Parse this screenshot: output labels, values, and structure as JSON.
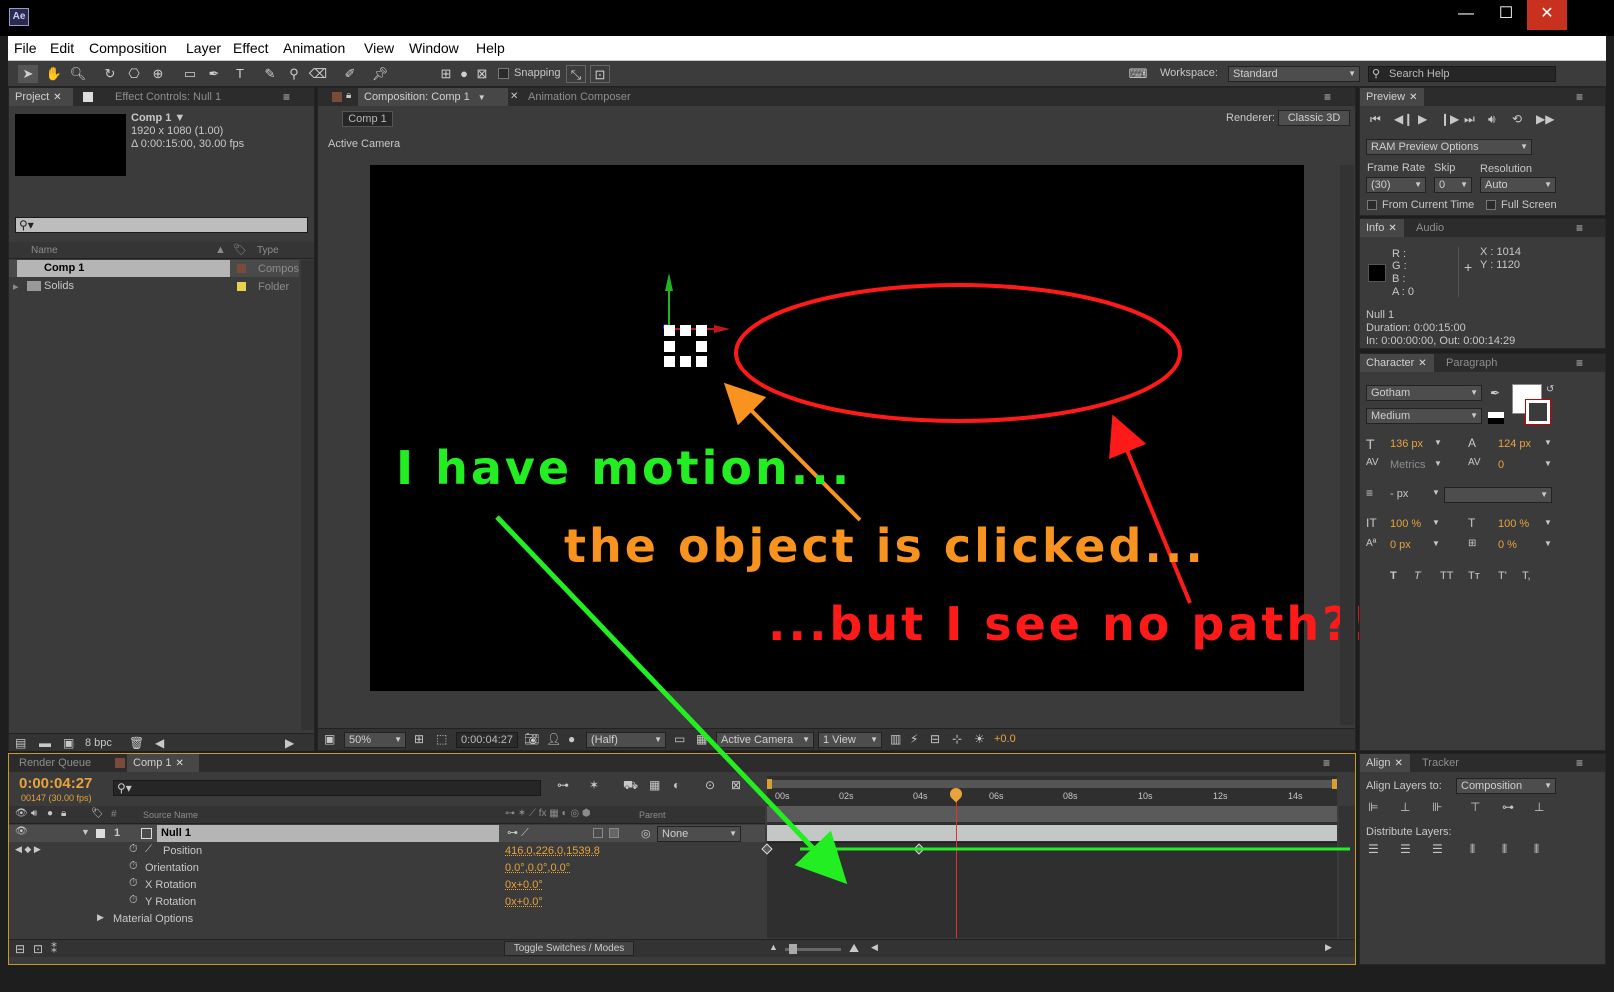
{
  "window": {
    "app_icon": "Ae",
    "min": "—",
    "max": "☐",
    "close": "✕"
  },
  "menu": [
    "File",
    "Edit",
    "Composition",
    "Layer",
    "Effect",
    "Animation",
    "View",
    "Window",
    "Help"
  ],
  "toolbar": {
    "snapping": "Snapping",
    "workspace_label": "Workspace:",
    "workspace_value": "Standard",
    "search_placeholder": "Search Help"
  },
  "project": {
    "tab": "Project",
    "effect_tab": "Effect Controls: Null 1",
    "comp_name": "Comp 1 ▼",
    "comp_size": "1920 x 1080 (1.00)",
    "comp_duration": "Δ 0:00:15:00, 30.00 fps",
    "col_name": "Name",
    "col_type": "Type",
    "items": [
      {
        "name": "Comp 1",
        "type": "Compos"
      },
      {
        "name": "Solids",
        "type": "Folder"
      }
    ],
    "bpc": "8 bpc"
  },
  "composition": {
    "tab": "Composition: Comp 1",
    "tab2": "Animation Composer",
    "crumb": "Comp 1",
    "renderer_label": "Renderer:",
    "renderer_value": "Classic 3D",
    "view_label": "Active Camera",
    "zoom": "50%",
    "timecode": "0:00:04:27",
    "resolution": "(Half)",
    "camera": "Active Camera",
    "views": "1 View",
    "exposure": "+0.0"
  },
  "annotations": {
    "motion": "I have motion...",
    "clicked": "the object is clicked...",
    "nopath": "...but I see no path?!"
  },
  "preview": {
    "tab": "Preview",
    "ram": "RAM Preview Options",
    "frame_rate_label": "Frame Rate",
    "skip_label": "Skip",
    "resolution_label": "Resolution",
    "frame_rate": "(30)",
    "skip": "0",
    "resolution": "Auto",
    "from_current": "From Current Time",
    "full_screen": "Full Screen"
  },
  "info": {
    "tab": "Info",
    "tab2": "Audio",
    "r": "R :",
    "g": "G :",
    "b": "B :",
    "a": "A : 0",
    "x": "X : 1014",
    "y": "Y : 1120",
    "layer": "Null 1",
    "duration": "Duration: 0:00:15:00",
    "inout": "In: 0:00:00:00, Out: 0:00:14:29"
  },
  "character": {
    "tab": "Character",
    "tab2": "Paragraph",
    "font": "Gotham",
    "style": "Medium",
    "size": "136 px",
    "leading": "124 px",
    "kerning": "Metrics",
    "tracking": "0",
    "stroke": "- px",
    "vscale": "100 %",
    "hscale": "100 %",
    "baseline": "0 px",
    "tsume": "0 %",
    "styles": [
      "T",
      "T",
      "TT",
      "Tт",
      "T'",
      "T,"
    ]
  },
  "align": {
    "tab": "Align",
    "tab2": "Tracker",
    "align_to_label": "Align Layers to:",
    "align_to": "Composition",
    "distribute": "Distribute Layers:"
  },
  "timeline": {
    "tab_rq": "Render Queue",
    "tab_comp": "Comp 1",
    "timecode": "0:00:04:27",
    "frames": "00147 (30.00 fps)",
    "col_source": "Source Name",
    "col_parent": "Parent",
    "layer_num": "1",
    "layer_name": "Null 1",
    "parent": "None",
    "props": [
      {
        "name": "Position",
        "value": "416.0,226.0,1539.8"
      },
      {
        "name": "Orientation",
        "value": "0.0°,0.0°,0.0°"
      },
      {
        "name": "X Rotation",
        "value": "0x+0.0°"
      },
      {
        "name": "Y Rotation",
        "value": "0x+0.0°"
      }
    ],
    "material": "Material Options",
    "toggle": "Toggle Switches / Modes",
    "ruler": [
      "00s",
      "02s",
      "04s",
      "06s",
      "08s",
      "10s",
      "12s",
      "14s"
    ]
  }
}
